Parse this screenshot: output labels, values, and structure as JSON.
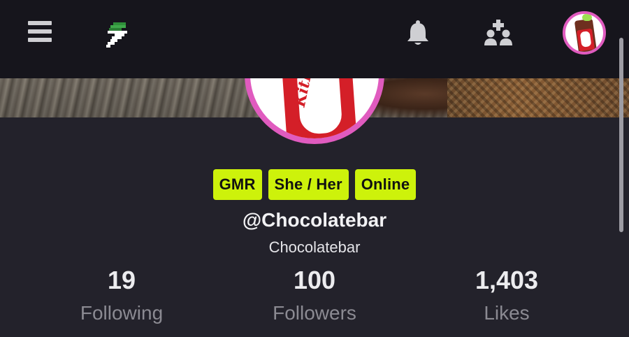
{
  "topbar": {
    "icons": [
      "menu-icon",
      "lightning-logo-icon",
      "bell-icon",
      "add-friend-icon",
      "user-avatar"
    ]
  },
  "colors": {
    "background": "#23222b",
    "topbar": "#16151c",
    "badge": "#cdf20b",
    "avatar_ring": "#e05bbf",
    "label_muted": "#8b8a92"
  },
  "profile": {
    "badges": [
      "GMR",
      "She / Her",
      "Online"
    ],
    "handle": "@Chocolatebar",
    "display_name": "Chocolatebar",
    "avatar_text": "KitKat"
  },
  "stats": {
    "following": {
      "value": "19",
      "label": "Following"
    },
    "followers": {
      "value": "100",
      "label": "Followers"
    },
    "likes": {
      "value": "1,403",
      "label": "Likes"
    }
  }
}
